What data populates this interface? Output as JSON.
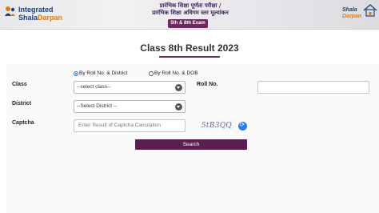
{
  "header": {
    "logo_left_line1": "Integrated",
    "logo_left_line2_a": "Shala",
    "logo_left_line2_b": "Darpan",
    "hindi_line1": "प्रारंभिक शिक्षा पूर्णता परीक्षा /",
    "hindi_line2": "प्रारंभिक शिक्षा अधिगम स्तर मूल्यांकन",
    "exam_badge": "5th & 8th Exam",
    "logo_right_line1": "Shala",
    "logo_right_line2": "Darpan"
  },
  "page": {
    "title": "Class 8th Result 2023"
  },
  "form": {
    "radio_roll_district": "By Roll No. & District",
    "radio_roll_dob": "By Roll No. & DOB",
    "selected_mode": "roll_district",
    "class_label": "Class",
    "class_select_value": "--select class--",
    "roll_label": "Roll No.",
    "roll_value": "",
    "district_label": "District",
    "district_select_value": "--Select District --",
    "captcha_label": "Captcha",
    "captcha_placeholder": "Enter Result of Captcha Calculation",
    "captcha_text": "5tB3QQ",
    "search_label": "Search"
  },
  "colors": {
    "accent": "#5a1f4f",
    "title_underline": "#6a2a5c",
    "refresh": "#2c7be5"
  }
}
